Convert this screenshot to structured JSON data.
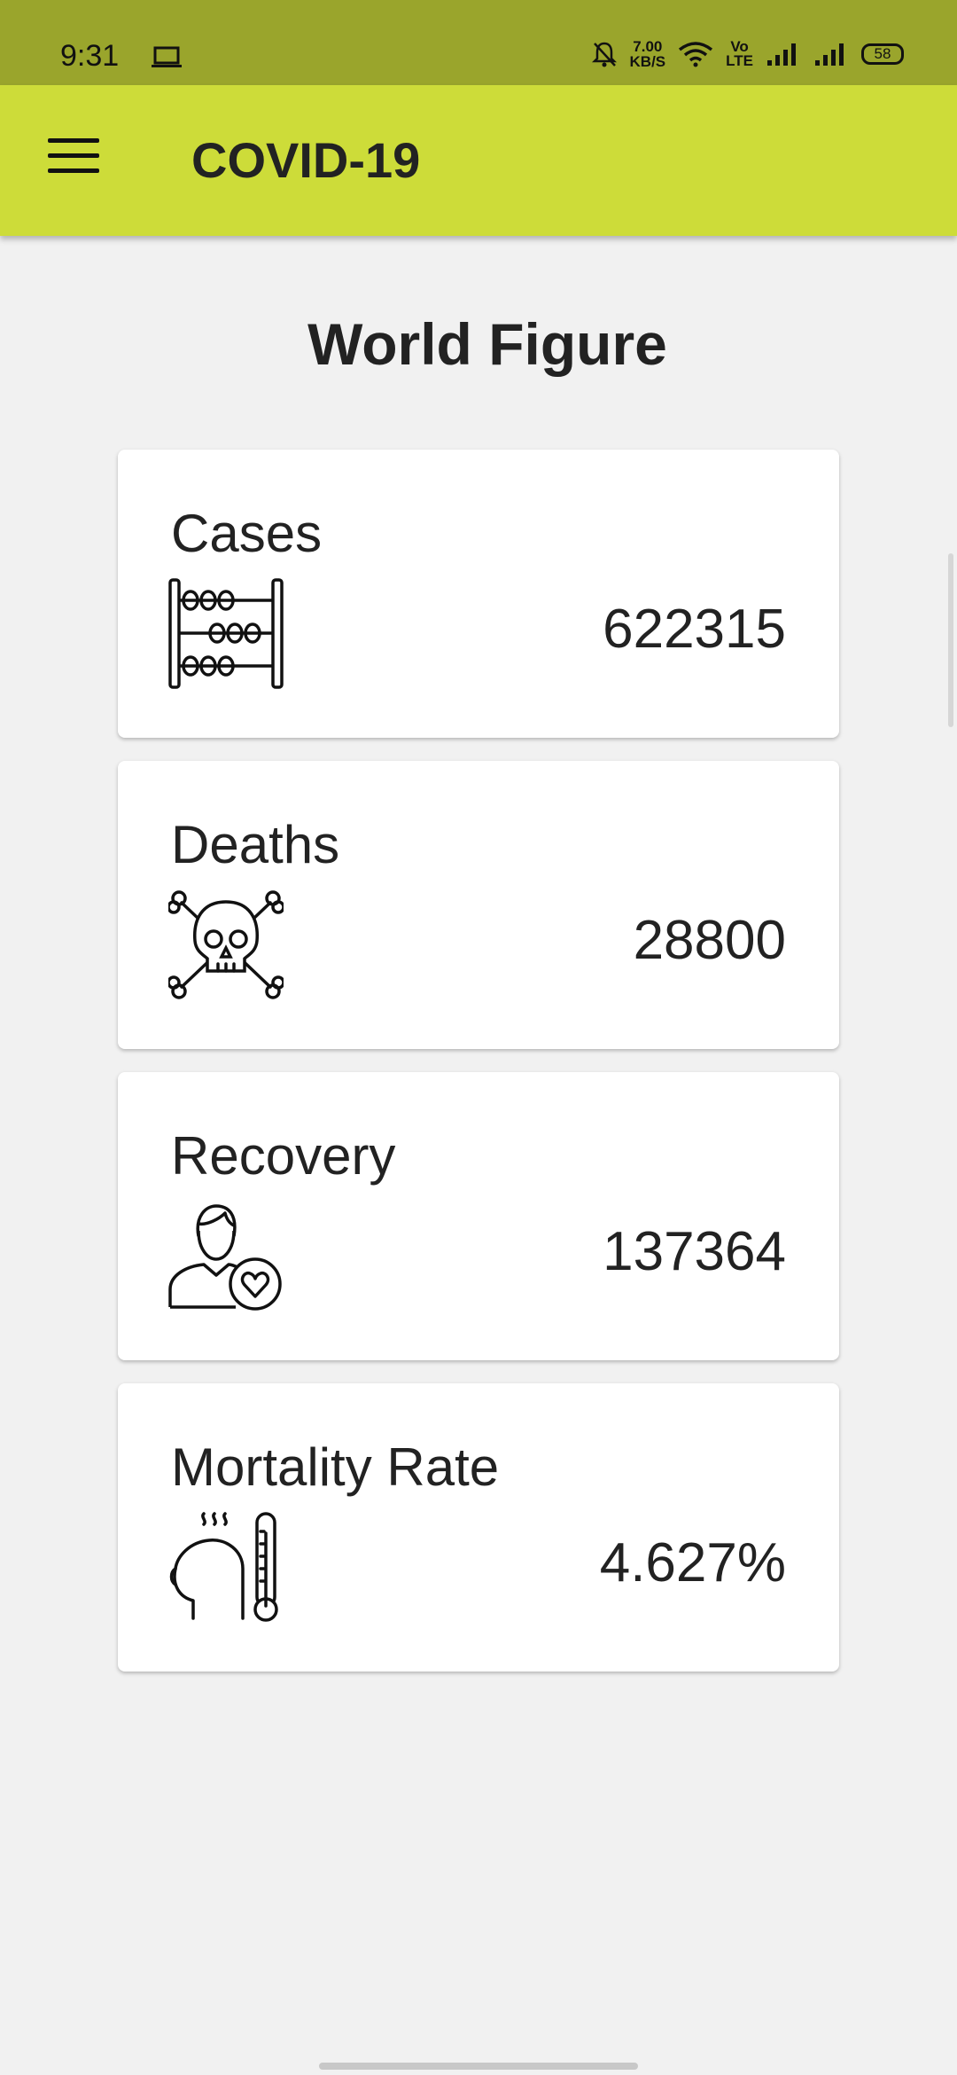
{
  "status_bar": {
    "time": "9:31",
    "speed_value": "7.00",
    "speed_unit": "KB/S",
    "volte_top": "Vo",
    "volte_bottom": "LTE",
    "battery": "58",
    "icons": [
      "laptop-icon",
      "mute-bell-icon",
      "wifi-icon",
      "signal-icon",
      "signal-icon",
      "battery-icon"
    ]
  },
  "app_bar": {
    "title": "COVID-19",
    "background": "#cddc39",
    "menu_icon": "hamburger-menu-icon"
  },
  "page": {
    "title": "World Figure"
  },
  "cards": [
    {
      "label": "Cases",
      "value": "622315",
      "icon": "abacus-icon"
    },
    {
      "label": "Deaths",
      "value": "28800",
      "icon": "skull-crossbones-icon"
    },
    {
      "label": "Recovery",
      "value": "137364",
      "icon": "person-heart-icon"
    },
    {
      "label": "Mortality Rate",
      "value": "4.627%",
      "icon": "fever-thermometer-icon"
    }
  ]
}
